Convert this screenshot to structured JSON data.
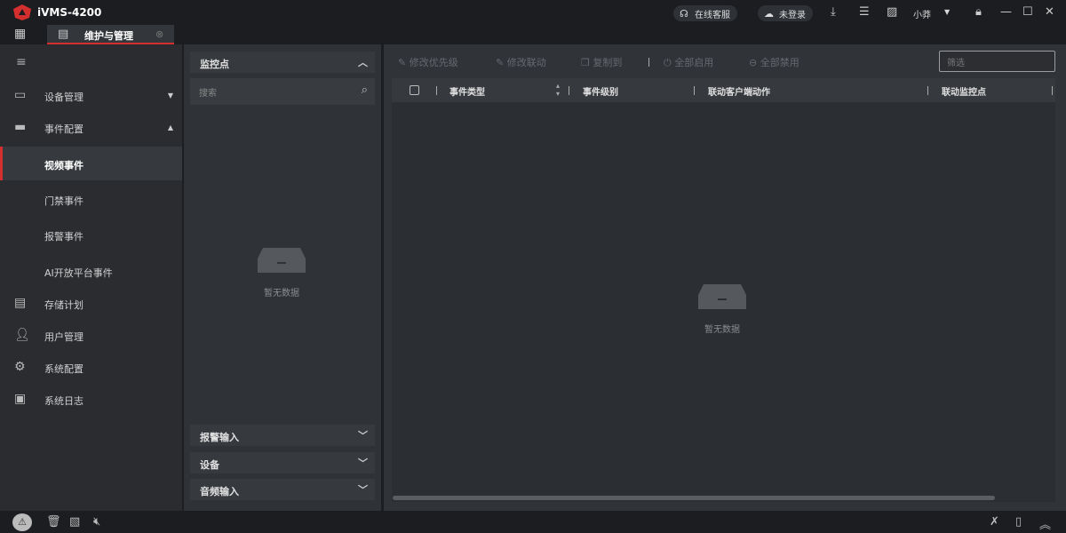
{
  "app": {
    "title": "iVMS-4200",
    "support": "在线客服",
    "login": "未登录",
    "user": "小莽"
  },
  "tab": {
    "label": "维护与管理"
  },
  "sidebar": {
    "items": [
      {
        "label": "设备管理",
        "icon": "device-icon"
      },
      {
        "label": "事件配置",
        "icon": "event-icon"
      },
      {
        "label": "视频事件"
      },
      {
        "label": "门禁事件"
      },
      {
        "label": "报警事件"
      },
      {
        "label": "AI开放平台事件"
      },
      {
        "label": "存储计划",
        "icon": "storage-icon"
      },
      {
        "label": "用户管理",
        "icon": "user-icon"
      },
      {
        "label": "系统配置",
        "icon": "gear-icon"
      },
      {
        "label": "系统日志",
        "icon": "log-icon"
      }
    ]
  },
  "middle": {
    "camera_section": "监控点",
    "search_placeholder": "搜索",
    "empty": "暂无数据",
    "sections": [
      "报警输入",
      "设备",
      "音频输入"
    ]
  },
  "toolbar": {
    "edit_priority": "修改优先级",
    "edit_linkage": "修改联动",
    "copy_to": "复制到",
    "enable_all": "全部启用",
    "disable_all": "全部禁用",
    "filter_placeholder": "筛选"
  },
  "table": {
    "columns": [
      "事件类型",
      "事件级别",
      "联动客户端动作",
      "联动监控点"
    ],
    "empty": "暂无数据"
  }
}
